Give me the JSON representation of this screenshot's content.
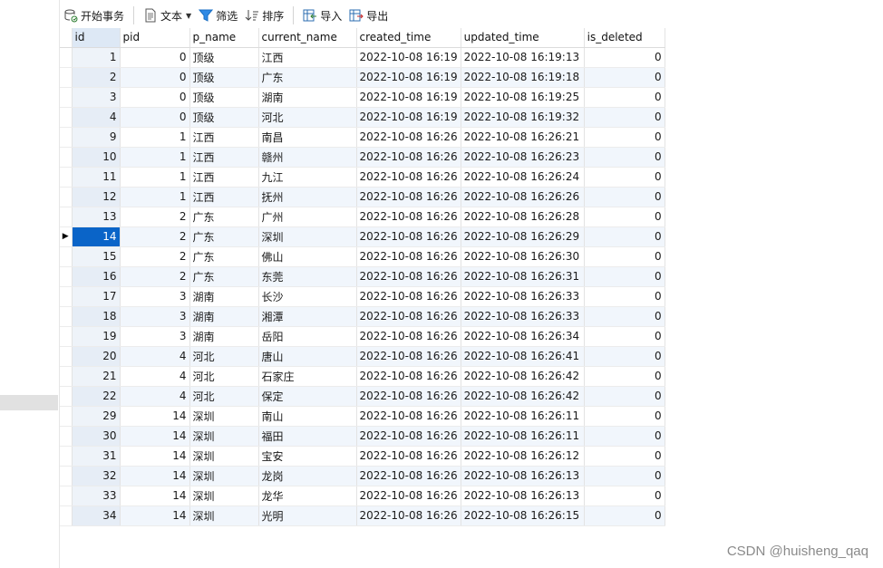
{
  "toolbar": {
    "begin_transaction": "开始事务",
    "text": "文本",
    "filter": "筛选",
    "sort": "排序",
    "import": "导入",
    "export": "导出"
  },
  "columns": [
    "id",
    "pid",
    "p_name",
    "current_name",
    "created_time",
    "updated_time",
    "is_deleted"
  ],
  "rows": [
    [
      "1",
      "0",
      "顶级",
      "江西",
      "2022-10-08 16:19",
      "2022-10-08 16:19:13",
      "0"
    ],
    [
      "2",
      "0",
      "顶级",
      "广东",
      "2022-10-08 16:19",
      "2022-10-08 16:19:18",
      "0"
    ],
    [
      "3",
      "0",
      "顶级",
      "湖南",
      "2022-10-08 16:19",
      "2022-10-08 16:19:25",
      "0"
    ],
    [
      "4",
      "0",
      "顶级",
      "河北",
      "2022-10-08 16:19",
      "2022-10-08 16:19:32",
      "0"
    ],
    [
      "9",
      "1",
      "江西",
      "南昌",
      "2022-10-08 16:26",
      "2022-10-08 16:26:21",
      "0"
    ],
    [
      "10",
      "1",
      "江西",
      "赣州",
      "2022-10-08 16:26",
      "2022-10-08 16:26:23",
      "0"
    ],
    [
      "11",
      "1",
      "江西",
      "九江",
      "2022-10-08 16:26",
      "2022-10-08 16:26:24",
      "0"
    ],
    [
      "12",
      "1",
      "江西",
      "抚州",
      "2022-10-08 16:26",
      "2022-10-08 16:26:26",
      "0"
    ],
    [
      "13",
      "2",
      "广东",
      "广州",
      "2022-10-08 16:26",
      "2022-10-08 16:26:28",
      "0"
    ],
    [
      "14",
      "2",
      "广东",
      "深圳",
      "2022-10-08 16:26",
      "2022-10-08 16:26:29",
      "0"
    ],
    [
      "15",
      "2",
      "广东",
      "佛山",
      "2022-10-08 16:26",
      "2022-10-08 16:26:30",
      "0"
    ],
    [
      "16",
      "2",
      "广东",
      "东莞",
      "2022-10-08 16:26",
      "2022-10-08 16:26:31",
      "0"
    ],
    [
      "17",
      "3",
      "湖南",
      "长沙",
      "2022-10-08 16:26",
      "2022-10-08 16:26:33",
      "0"
    ],
    [
      "18",
      "3",
      "湖南",
      "湘潭",
      "2022-10-08 16:26",
      "2022-10-08 16:26:33",
      "0"
    ],
    [
      "19",
      "3",
      "湖南",
      "岳阳",
      "2022-10-08 16:26",
      "2022-10-08 16:26:34",
      "0"
    ],
    [
      "20",
      "4",
      "河北",
      "唐山",
      "2022-10-08 16:26",
      "2022-10-08 16:26:41",
      "0"
    ],
    [
      "21",
      "4",
      "河北",
      "石家庄",
      "2022-10-08 16:26",
      "2022-10-08 16:26:42",
      "0"
    ],
    [
      "22",
      "4",
      "河北",
      "保定",
      "2022-10-08 16:26",
      "2022-10-08 16:26:42",
      "0"
    ],
    [
      "29",
      "14",
      "深圳",
      "南山",
      "2022-10-08 16:26",
      "2022-10-08 16:26:11",
      "0"
    ],
    [
      "30",
      "14",
      "深圳",
      "福田",
      "2022-10-08 16:26",
      "2022-10-08 16:26:11",
      "0"
    ],
    [
      "31",
      "14",
      "深圳",
      "宝安",
      "2022-10-08 16:26",
      "2022-10-08 16:26:12",
      "0"
    ],
    [
      "32",
      "14",
      "深圳",
      "龙岗",
      "2022-10-08 16:26",
      "2022-10-08 16:26:13",
      "0"
    ],
    [
      "33",
      "14",
      "深圳",
      "龙华",
      "2022-10-08 16:26",
      "2022-10-08 16:26:13",
      "0"
    ],
    [
      "34",
      "14",
      "深圳",
      "光明",
      "2022-10-08 16:26",
      "2022-10-08 16:26:15",
      "0"
    ]
  ],
  "selected_row_index": 9,
  "selected_column": "id",
  "watermark": "CSDN @huisheng_qaq",
  "colors": {
    "selection": "#0a64c8",
    "alt_row": "#f1f6fc",
    "header_selected": "#dde8f5"
  }
}
